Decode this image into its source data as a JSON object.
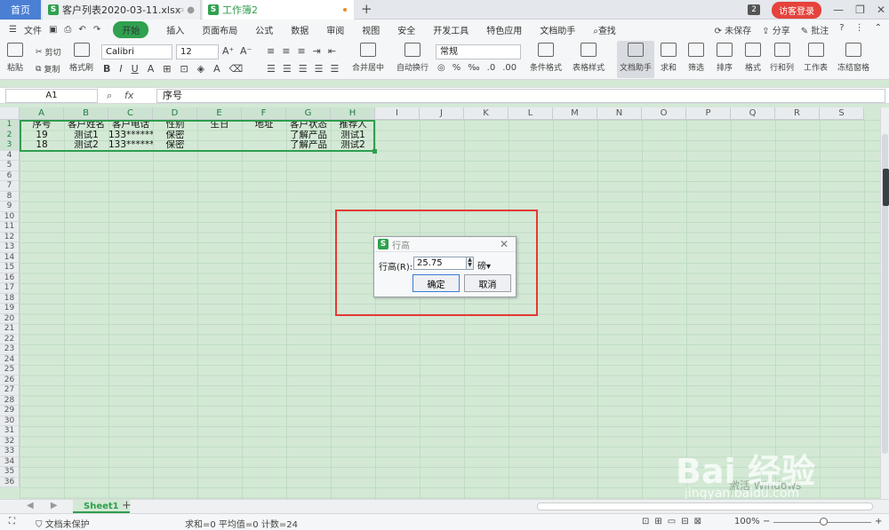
{
  "titlebar": {
    "home": "首页",
    "file_tab": "客户列表2020-03-11.xlsx",
    "active_tab": "工作簿2",
    "new_tab": "+",
    "tab_count": "2",
    "login": "访客登录",
    "minimize": "—",
    "restore": "❐",
    "close": "✕"
  },
  "menubar": {
    "file": "文件",
    "items": [
      "开始",
      "插入",
      "页面布局",
      "公式",
      "数据",
      "审阅",
      "视图",
      "安全",
      "开发工具",
      "特色应用",
      "文档助手",
      "查找"
    ],
    "unsaved": "未保存",
    "share": "分享",
    "comment": "批注"
  },
  "ribbon": {
    "paste": "粘贴",
    "cut": "剪切",
    "copy": "复制",
    "format_painter": "格式刷",
    "font": "Calibri",
    "font_size": "12",
    "font_grow": "A⁺",
    "font_shrink": "A⁻",
    "merge": "合并居中",
    "wrap": "自动换行",
    "number_format": "常规",
    "cond_format": "条件格式",
    "table_style": "表格样式",
    "doc_helper": "文档助手",
    "sum": "求和",
    "filter": "筛选",
    "sort": "排序",
    "format": "格式",
    "rowcol": "行和列",
    "worksheet": "工作表",
    "freeze": "冻结窗格"
  },
  "formula": {
    "namebox": "A1",
    "fx": "fx",
    "content": "序号"
  },
  "columns": [
    "A",
    "B",
    "C",
    "D",
    "E",
    "F",
    "G",
    "H",
    "I",
    "J",
    "K",
    "L",
    "M",
    "N",
    "O",
    "P",
    "Q",
    "R",
    "S"
  ],
  "rows": [
    "1",
    "2",
    "3",
    "4",
    "5",
    "6",
    "7",
    "8",
    "9",
    "10",
    "11",
    "12",
    "13",
    "14",
    "15",
    "16",
    "17",
    "18",
    "19",
    "20",
    "21",
    "22",
    "23",
    "24",
    "25",
    "26",
    "27",
    "28",
    "29",
    "30",
    "31",
    "32",
    "33",
    "34",
    "35",
    "36"
  ],
  "table": {
    "header": [
      "序号",
      "客户姓名",
      "客户电话",
      "性别",
      "生日",
      "地址",
      "客户状态",
      "推荐人"
    ],
    "rows": [
      [
        "19",
        "测试1",
        "133*******",
        "保密",
        "",
        "",
        "了解产品",
        "测试1"
      ],
      [
        "18",
        "测试2",
        "133*******",
        "保密",
        "",
        "",
        "了解产品",
        "测试2"
      ]
    ]
  },
  "sheet": {
    "tab": "Sheet1",
    "add": "+"
  },
  "status": {
    "protect": "文档未保护",
    "stats": "求和=0  平均值=0  计数=24",
    "zoom": "100%"
  },
  "dialog": {
    "title": "行高",
    "label": "行高(R):",
    "value": "25.75",
    "unit": "磅",
    "ok": "确定",
    "cancel": "取消",
    "close": "✕"
  },
  "watermark": {
    "main": "Bai 经验",
    "sub": "jingyan.baidu.com",
    "activate": "激活 Windows"
  }
}
